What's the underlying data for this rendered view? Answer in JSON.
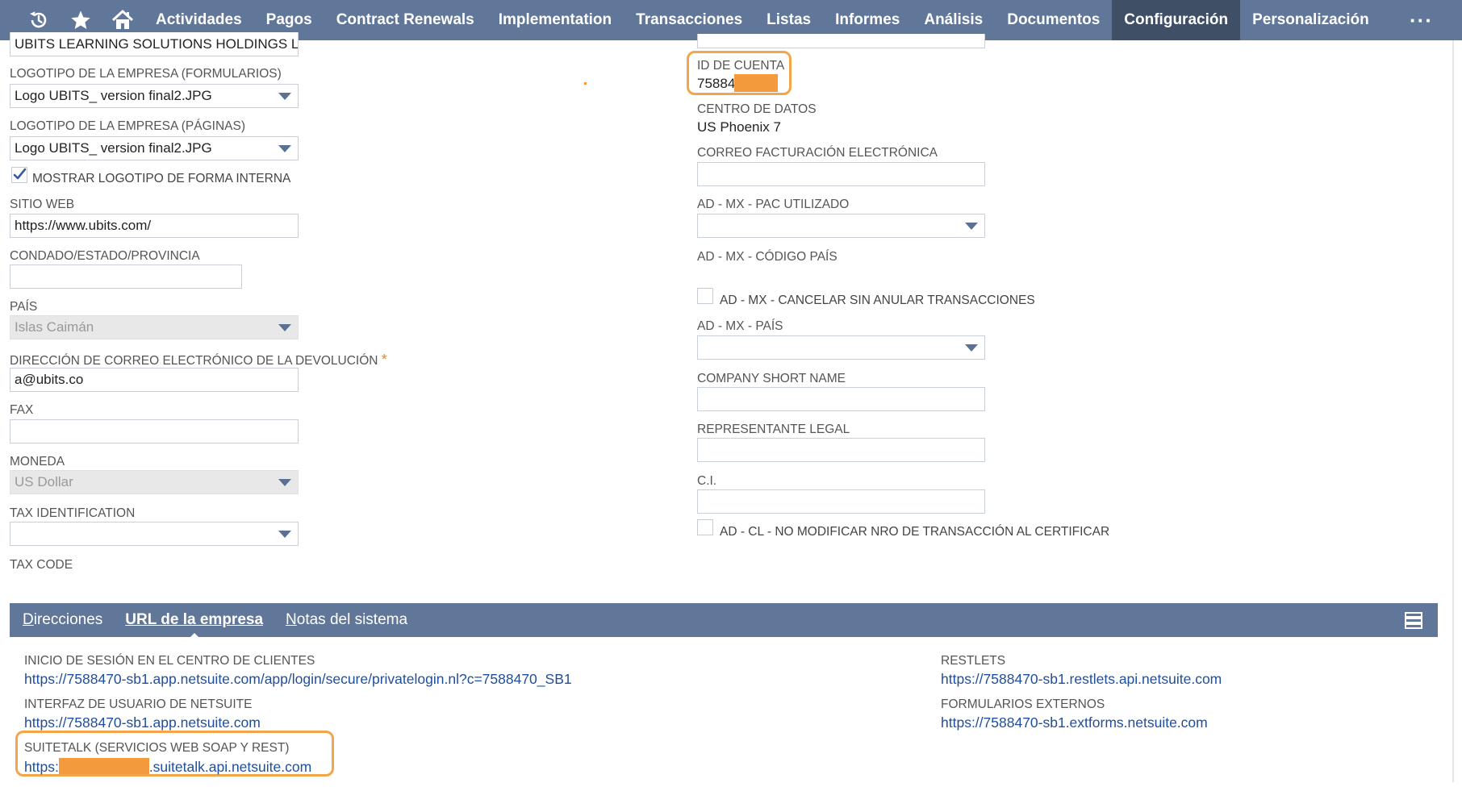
{
  "nav": {
    "icons": [
      "history-icon",
      "star-icon",
      "home-icon"
    ],
    "items": [
      "Actividades",
      "Pagos",
      "Contract Renewals",
      "Implementation",
      "Transacciones",
      "Listas",
      "Informes",
      "Análisis",
      "Documentos",
      "Configuración",
      "Personalización"
    ],
    "active": "Configuración",
    "more": "···"
  },
  "left": {
    "company_name_value": "UBITS LEARNING SOLUTIONS HOLDINGS LIM",
    "logo_forms": {
      "label": "LOGOTIPO DE LA EMPRESA (FORMULARIOS)",
      "value": "Logo UBITS_ version final2.JPG"
    },
    "logo_pages": {
      "label": "LOGOTIPO DE LA EMPRESA (PÁGINAS)",
      "value": "Logo UBITS_ version final2.JPG"
    },
    "show_logo": {
      "label": "MOSTRAR LOGOTIPO DE FORMA INTERNA",
      "checked": true
    },
    "website": {
      "label": "SITIO WEB",
      "value": "https://www.ubits.com/"
    },
    "state": {
      "label": "CONDADO/ESTADO/PROVINCIA",
      "value": ""
    },
    "country": {
      "label": "PAÍS",
      "value": "Islas Caimán"
    },
    "return_email": {
      "label": "DIRECCIÓN DE CORREO ELECTRÓNICO DE LA DEVOLUCIÓN",
      "required_mark": "*",
      "value": "a@ubits.co"
    },
    "fax": {
      "label": "FAX",
      "value": ""
    },
    "currency": {
      "label": "MONEDA",
      "value": "US Dollar"
    },
    "tax_id": {
      "label": "TAX IDENTIFICATION",
      "value": ""
    },
    "tax_code": {
      "label": "TAX CODE"
    }
  },
  "right": {
    "account_id": {
      "label": "ID DE CUENTA",
      "value": "75884"
    },
    "data_center": {
      "label": "CENTRO DE DATOS",
      "value": "US Phoenix 7"
    },
    "e_invoice_email": {
      "label": "CORREO FACTURACIÓN ELECTRÓNICA",
      "value": ""
    },
    "pac": {
      "label": "AD - MX - PAC UTILIZADO",
      "value": ""
    },
    "country_code": {
      "label": "AD - MX - CÓDIGO PAÍS"
    },
    "cancel_no_void": {
      "label": "AD - MX - CANCELAR SIN ANULAR TRANSACCIONES",
      "checked": false
    },
    "mx_country": {
      "label": "AD - MX - PAÍS",
      "value": ""
    },
    "short_name": {
      "label": "COMPANY SHORT NAME",
      "value": ""
    },
    "legal_rep": {
      "label": "REPRESENTANTE LEGAL",
      "value": ""
    },
    "ci": {
      "label": "C.I.",
      "value": ""
    },
    "no_modify": {
      "label": "AD - CL - NO MODIFICAR NRO DE TRANSACCIÓN AL CERTIFICAR",
      "checked": false
    }
  },
  "subtabs": {
    "items": [
      {
        "first": "D",
        "rest": "irecciones"
      },
      {
        "first": "U",
        "rest": "RL de la empresa"
      },
      {
        "first": "N",
        "rest": "otas del sistema"
      }
    ],
    "active_index": 1
  },
  "urls": {
    "customer_login": {
      "label": "INICIO DE SESIÓN EN EL CENTRO DE CLIENTES",
      "value": "https://7588470-sb1.app.netsuite.com/app/login/secure/privatelogin.nl?c=7588470_SB1"
    },
    "netsuite_ui": {
      "label": "INTERFAZ DE USUARIO DE NETSUITE",
      "value": "https://7588470-sb1.app.netsuite.com"
    },
    "suitetalk": {
      "label": "SUITETALK (SERVICIOS WEB SOAP Y REST)",
      "prefix": "https:",
      "suffix": ".suitetalk.api.netsuite.com"
    },
    "restlets": {
      "label": "RESTLETS",
      "value": "https://7588470-sb1.restlets.api.netsuite.com"
    },
    "external_forms": {
      "label": "FORMULARIOS EXTERNOS",
      "value": "https://7588470-sb1.extforms.netsuite.com"
    }
  },
  "colors": {
    "nav_bg": "#607799",
    "nav_active": "#3e4f66",
    "highlight": "#f3a54a",
    "redaction": "#f39a3d",
    "link": "#1f4e9c"
  }
}
